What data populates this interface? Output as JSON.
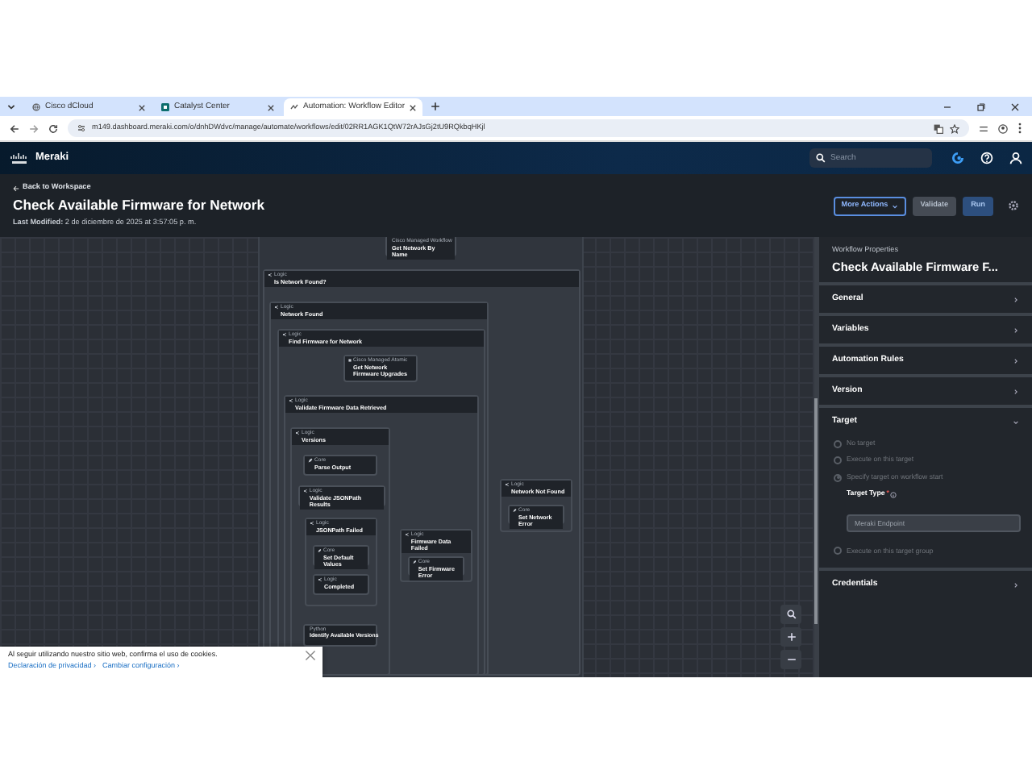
{
  "browser": {
    "tabs": [
      {
        "title": "Cisco dCloud",
        "selected": false
      },
      {
        "title": "Catalyst Center",
        "selected": false
      },
      {
        "title": "Automation: Workflow Editor",
        "selected": true
      }
    ],
    "url": "m149.dashboard.meraki.com/o/dnhDWdvc/manage/automate/workflows/edit/02RR1AGK1QtW72rAJsGj2tU9RQkbqHKjl"
  },
  "app_bar": {
    "brand": "Meraki",
    "search": {
      "placeholder": "Search"
    }
  },
  "header": {
    "back_link": "Back to Workspace",
    "title": "Check Available Firmware for Network",
    "modified_label": "Last Modified:",
    "modified_value": "2 de diciembre de 2025 at 3:57:05 p. m.",
    "buttons": [
      {
        "label": "More Actions",
        "kind": "dropdown",
        "disabled": false
      },
      {
        "label": "Validate",
        "kind": "secondary",
        "disabled": true
      },
      {
        "label": "Run",
        "kind": "primary",
        "disabled": false
      }
    ]
  },
  "canvas": {
    "nodes": [
      {
        "kind": "workflow",
        "type_label": "Cisco Managed Workflow",
        "label": "Get Network By Name"
      },
      {
        "kind": "logic",
        "type_label": "Logic",
        "label": "Is Network Found?",
        "children": [
          {
            "kind": "logic",
            "type_label": "Logic",
            "label": "Network Found",
            "children": [
              {
                "kind": "logic",
                "type_label": "Logic",
                "label": "Find Firmware for Network",
                "children": [
                  {
                    "kind": "atomic",
                    "type_label": "Cisco Managed Atomic",
                    "label": "Get Network Firmware Upgrades"
                  },
                  {
                    "kind": "logic",
                    "type_label": "Logic",
                    "label": "Validate Firmware Data Retrieved",
                    "children": [
                      {
                        "kind": "logic",
                        "type_label": "Logic",
                        "label": "Versions",
                        "children": [
                          {
                            "kind": "core",
                            "type_label": "Core",
                            "label": "Parse Output"
                          },
                          {
                            "kind": "logic",
                            "type_label": "Logic",
                            "label": "Validate JSONPath Results"
                          },
                          {
                            "kind": "logic",
                            "type_label": "Logic",
                            "label": "JSONPath Failed",
                            "children": [
                              {
                                "kind": "core",
                                "type_label": "Core",
                                "label": "Set Default Values"
                              },
                              {
                                "kind": "logic",
                                "type_label": "Logic",
                                "label": "Completed"
                              }
                            ]
                          },
                          {
                            "kind": "python",
                            "type_label": "Python",
                            "label": "Identify Available Versions"
                          }
                        ]
                      },
                      {
                        "kind": "logic",
                        "type_label": "Logic",
                        "label": "Firmware Data Failed",
                        "children": [
                          {
                            "kind": "core",
                            "type_label": "Core",
                            "label": "Set Firmware Error"
                          }
                        ]
                      }
                    ]
                  }
                ]
              }
            ]
          },
          {
            "kind": "logic",
            "type_label": "Logic",
            "label": "Network Not Found",
            "children": [
              {
                "kind": "core",
                "type_label": "Core",
                "label": "Set Network Error"
              }
            ]
          }
        ]
      }
    ]
  },
  "properties": {
    "caption": "Workflow Properties",
    "title": "Check Available Firmware F...",
    "sections": [
      {
        "label": "General",
        "expanded": false
      },
      {
        "label": "Variables",
        "expanded": false
      },
      {
        "label": "Automation Rules",
        "expanded": false
      },
      {
        "label": "Version",
        "expanded": false
      },
      {
        "label": "Target",
        "expanded": true,
        "options": [
          {
            "label": "No target",
            "selected": false,
            "disabled": true
          },
          {
            "label": "Execute on this target",
            "selected": false,
            "disabled": true
          },
          {
            "label": "Specify target on workflow start",
            "selected": true,
            "disabled": true,
            "field": {
              "label": "Target Type",
              "required_mark": "*",
              "value": "Meraki Endpoint"
            }
          },
          {
            "label": "Execute on this target group",
            "selected": false,
            "disabled": true
          }
        ]
      },
      {
        "label": "Credentials",
        "expanded": false
      }
    ]
  },
  "cookie_banner": {
    "text": "Al seguir utilizando nuestro sitio web, confirma el uso de cookies.",
    "links": [
      "Declaración de privacidad ›",
      "Cambiar configuración ›"
    ]
  }
}
